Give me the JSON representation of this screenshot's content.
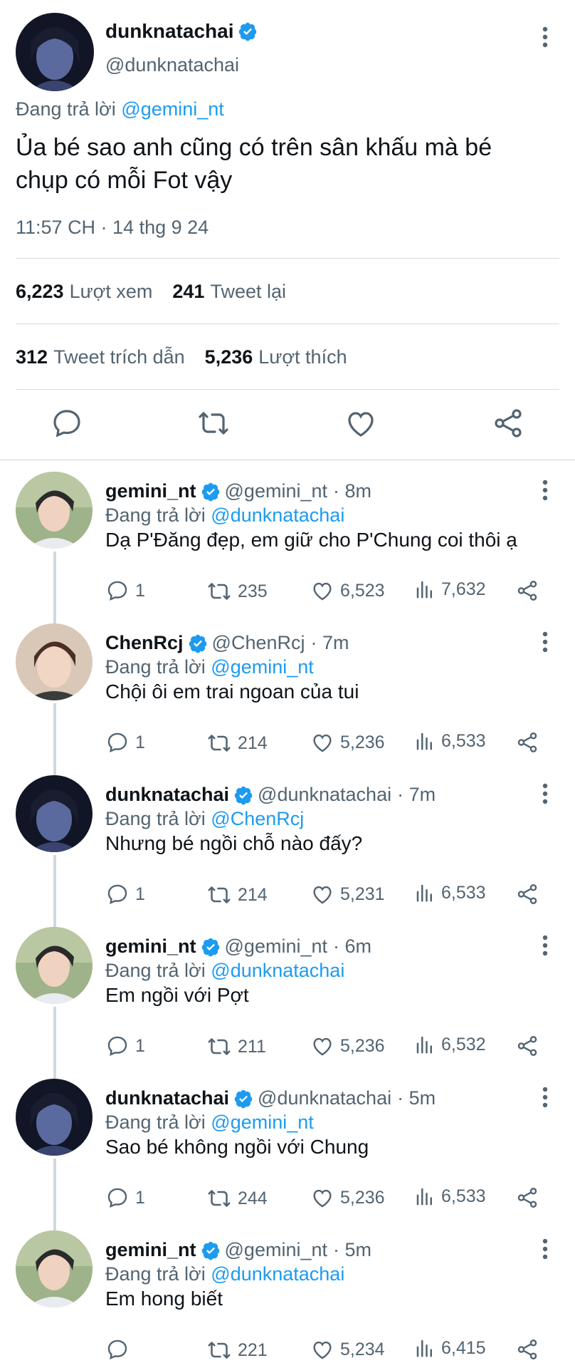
{
  "main_tweet": {
    "author_name": "dunknatachai",
    "author_handle": "@dunknatachai",
    "replying_prefix": "Đang trả lời",
    "replying_to": "@gemini_nt",
    "text_line1": "Ủa bé sao anh cũng có trên sân khấu mà bé",
    "text_line2": "chụp có mỗi Fot vậy",
    "timestamp": "11:57 CH · 14 thg 9 24",
    "views_count": "6,223",
    "views_label": "Lượt xem",
    "retweets_count": "241",
    "retweets_label": "Tweet lại",
    "quotes_count": "312",
    "quotes_label": "Tweet trích dẫn",
    "likes_count": "5,236",
    "likes_label": "Lượt thích"
  },
  "replies": [
    {
      "name": "gemini_nt",
      "handle": "@gemini_nt",
      "time": "· 8m",
      "replying_prefix": "Đang trả lời",
      "replying_to": "@dunknatachai",
      "text": "Dạ P'Đăng đẹp, em giữ cho P'Chung coi thôi ạ",
      "replies": "1",
      "retweets": "235",
      "likes": "6,523",
      "views": "7,632",
      "avatar": "gemini"
    },
    {
      "name": "ChenRcj",
      "handle": "@ChenRcj",
      "time": "· 7m",
      "replying_prefix": "Đang trả lời",
      "replying_to": "@gemini_nt",
      "text": "Chội ôi em trai ngoan của tui",
      "replies": "1",
      "retweets": "214",
      "likes": "5,236",
      "views": "6,533",
      "avatar": "chen"
    },
    {
      "name": "dunknatachai",
      "handle": "@dunknatachai",
      "time": "· 7m",
      "replying_prefix": "Đang trả lời",
      "replying_to": "@ChenRcj",
      "text": "Nhưng bé ngồi chỗ nào đấy?",
      "replies": "1",
      "retweets": "214",
      "likes": "5,231",
      "views": "6,533",
      "avatar": "dunk"
    },
    {
      "name": "gemini_nt",
      "handle": "@gemini_nt",
      "time": "· 6m",
      "replying_prefix": "Đang trả lời",
      "replying_to": "@dunknatachai",
      "text": "Em ngồi với Pợt",
      "replies": "1",
      "retweets": "211",
      "likes": "5,236",
      "views": "6,532",
      "avatar": "gemini"
    },
    {
      "name": "dunknatachai",
      "handle": "@dunknatachai",
      "time": "· 5m",
      "replying_prefix": "Đang trả lời",
      "replying_to": "@gemini_nt",
      "text": "Sao bé không ngồi với Chung",
      "replies": "1",
      "retweets": "244",
      "likes": "5,236",
      "views": "6,533",
      "avatar": "dunk"
    },
    {
      "name": "gemini_nt",
      "handle": "@gemini_nt",
      "time": "· 5m",
      "replying_prefix": "Đang trả lời",
      "replying_to": "@dunknatachai",
      "text": "Em hong biết",
      "replies": "",
      "retweets": "221",
      "likes": "5,234",
      "views": "6,415",
      "avatar": "gemini"
    }
  ],
  "colors": {
    "accent": "#1d9bf0",
    "muted_text": "#536471",
    "primary_text": "#0f1419",
    "verified_badge": "#1d9bf0"
  }
}
